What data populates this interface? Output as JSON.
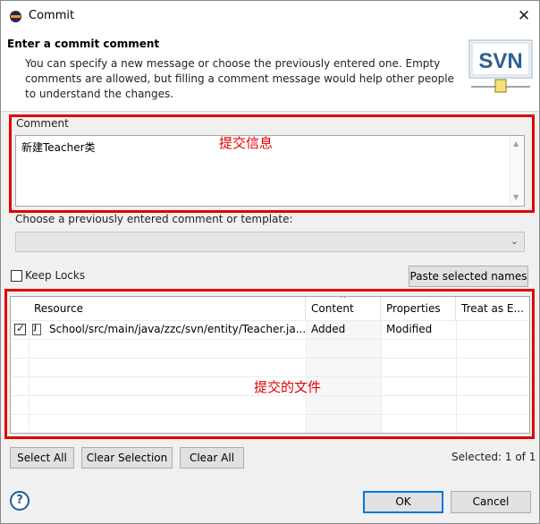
{
  "window": {
    "title": "Commit",
    "close_glyph": "✕"
  },
  "header": {
    "title": "Enter a commit comment",
    "description": "You can specify a new message or choose the previously entered one. Empty comments are allowed, but filling a comment message would help other people to understand the changes.",
    "logo_text": "SVN"
  },
  "comment": {
    "label": "Comment",
    "value": "新建Teacher类",
    "annotation": "提交信息"
  },
  "previous": {
    "label": "Choose a previously entered comment or template:",
    "selected": ""
  },
  "keep_locks": {
    "label": "Keep Locks",
    "checked": false
  },
  "paste_button": "Paste selected names",
  "table": {
    "columns": [
      "Resource",
      "Content",
      "Properties",
      "Treat as E..."
    ],
    "rows": [
      {
        "checked": true,
        "resource": "School/src/main/java/zzc/svn/entity/Teacher.ja...",
        "content": "Added",
        "properties": "Modified",
        "treat": ""
      }
    ],
    "annotation": "提交的文件"
  },
  "buttons": {
    "select_all": "Select All",
    "clear_selection": "Clear Selection",
    "clear_all": "Clear All",
    "ok": "OK",
    "cancel": "Cancel"
  },
  "status": {
    "selected": "Selected: 1 of 1"
  },
  "colors": {
    "annotation_red": "#e00000",
    "svn_blue": "#2f5f8f",
    "ok_border": "#0078d7"
  },
  "icons": [
    "eclipse-icon",
    "close-icon",
    "svn-logo",
    "file-java-icon",
    "help-icon",
    "sort-caret-icon",
    "dropdown-arrow-icon"
  ]
}
